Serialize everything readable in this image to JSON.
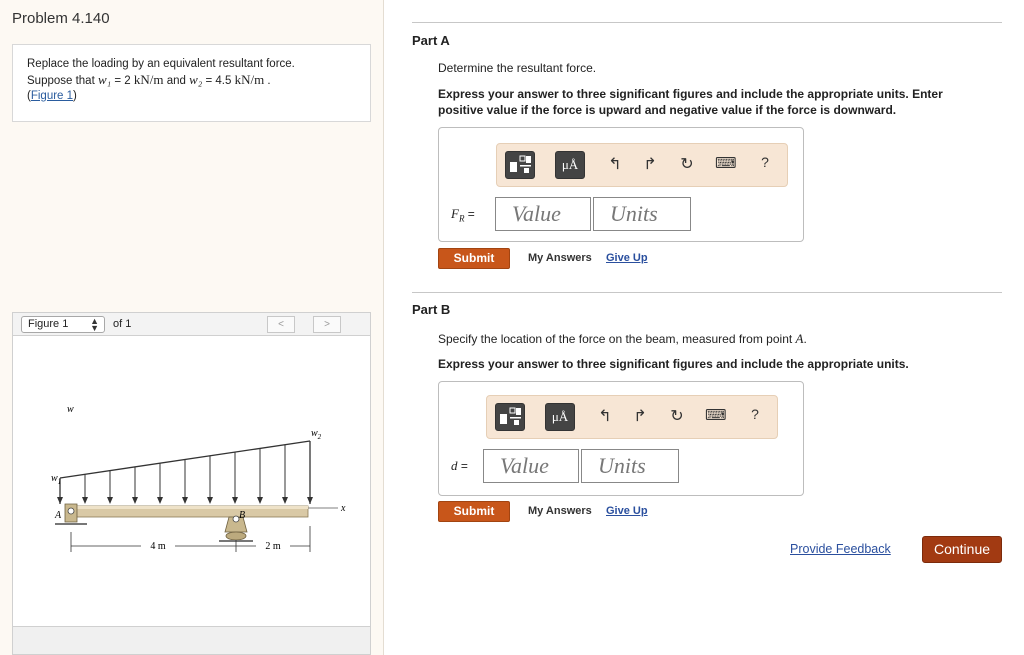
{
  "problem": {
    "title": "Problem 4.140",
    "line1": "Replace the loading by an equivalent resultant force.",
    "line2_pre": "Suppose that",
    "w1_var": "w₁",
    "w1_eq": " = 2 ",
    "w1_unit": "kN/m",
    "and": " and ",
    "w2_var": "w₂",
    "w2_eq": " = 4.5 ",
    "w2_unit": "kN/m",
    "period": " .",
    "figure_link_open": "(",
    "figure_link": "Figure 1",
    "figure_link_close": ")"
  },
  "figure": {
    "select_label": "Figure 1",
    "of_label": "of 1",
    "prev": "<",
    "next": ">",
    "labels": {
      "w_top": "w",
      "w2": "w",
      "w2_sub": "2",
      "w1": "w",
      "w1_sub": "1",
      "A": "A",
      "B": "B",
      "x": "x",
      "dim1": "4 m",
      "dim2": "2 m"
    }
  },
  "partA": {
    "title": "Part A",
    "instruction": "Determine the resultant force.",
    "express": "Express your answer to three significant figures and include the appropriate units. Enter",
    "express2": "positive value if the force is upward and negative value if the force is downward.",
    "var": "F",
    "var_sub": "R",
    "eq": " =",
    "value_placeholder": "Value",
    "units_placeholder": "Units",
    "submit": "Submit",
    "my_answers": "My Answers",
    "give_up": "Give Up"
  },
  "partB": {
    "title": "Part B",
    "instruction_pre": "Specify the location of the force on the beam, measured from point ",
    "instruction_var": "A",
    "instruction_post": ".",
    "express": "Express your answer to three significant figures and include the appropriate units.",
    "var": "d",
    "eq": " =",
    "value_placeholder": "Value",
    "units_placeholder": "Units",
    "submit": "Submit",
    "my_answers": "My Answers",
    "give_up": "Give Up"
  },
  "toolbar": {
    "mu": "μÅ",
    "undo": "↰",
    "redo": "↱",
    "reset": "↻",
    "keyboard": "⌨",
    "help": "?"
  },
  "footer": {
    "feedback": "Provide Feedback",
    "continue": "Continue"
  }
}
